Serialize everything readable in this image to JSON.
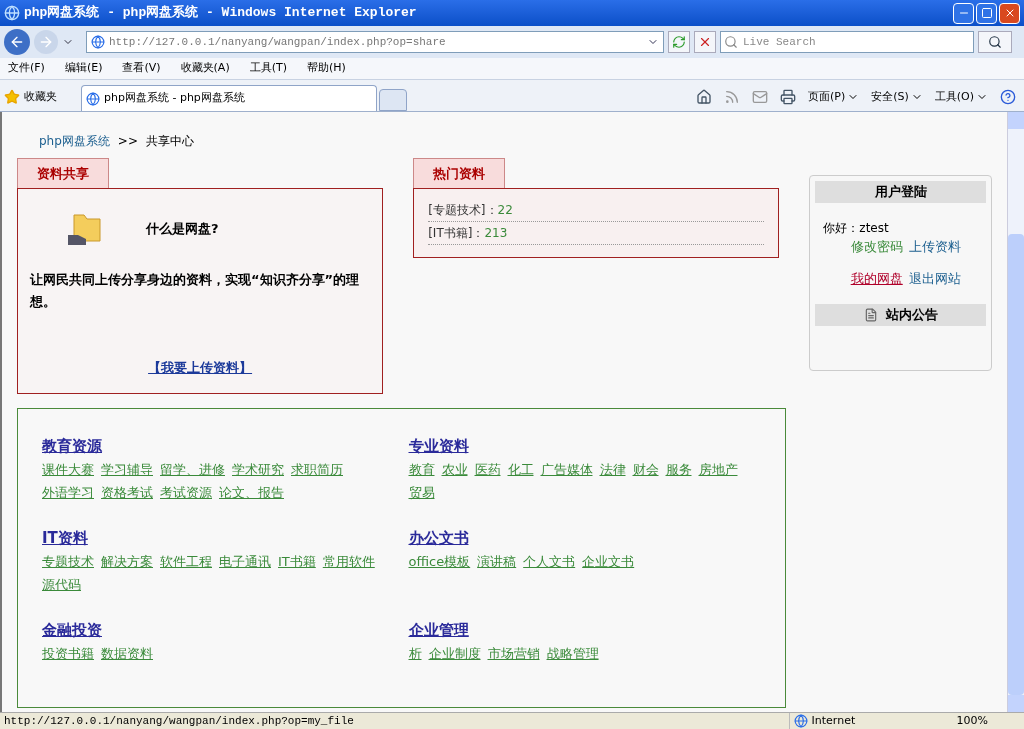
{
  "window": {
    "title": "php网盘系统 - php网盘系统 - Windows Internet Explorer"
  },
  "address_bar": {
    "url": "http://127.0.0.1/nanyang/wangpan/index.php?op=share"
  },
  "search": {
    "placeholder": "Live Search"
  },
  "menu": [
    "文件(F)",
    "编辑(E)",
    "查看(V)",
    "收藏夹(A)",
    "工具(T)",
    "帮助(H)"
  ],
  "favorites": {
    "label": "收藏夹"
  },
  "tabs": [
    {
      "label": "php网盘系统 - php网盘系统",
      "selected": true
    }
  ],
  "command_bar": [
    "页面(P)",
    "安全(S)",
    "工具(O)"
  ],
  "breadcrumb": {
    "home": "php网盘系统",
    "separator": ">>",
    "current": "共享中心"
  },
  "share_panel": {
    "tab": "资料共享",
    "heading": "什么是网盘?",
    "description": "让网民共同上传分享身边的资料，实现“知识齐分享”的理想。",
    "upload_link": "【我要上传资料】"
  },
  "hot_panel": {
    "tab": "热门资料",
    "items": [
      {
        "label": "[专题技术]：",
        "count": "22"
      },
      {
        "label": "[IT书籍]：",
        "count": "213"
      }
    ]
  },
  "login": {
    "title": "用户登陆",
    "greeting": "你好：ztest",
    "links": [
      {
        "label": "修改密码",
        "visited": true,
        "hovered": false
      },
      {
        "label": "上传资料",
        "visited": false,
        "hovered": false
      },
      {
        "label": "我的网盘",
        "visited": false,
        "hovered": true
      },
      {
        "label": "退出网站",
        "visited": false,
        "hovered": false
      }
    ]
  },
  "notice": {
    "title": "站内公告"
  },
  "categories": [
    {
      "title": "教育资源",
      "links": [
        "课件大赛",
        "学习辅导",
        "留学、进修",
        "学术研究",
        "求职简历",
        "外语学习",
        "资格考试",
        "考试资源",
        "论文、报告"
      ]
    },
    {
      "title": "专业资料",
      "links": [
        "教育",
        "农业",
        "医药",
        "化工",
        "广告媒体",
        "法律",
        "财会",
        "服务",
        "房地产",
        "贸易"
      ]
    },
    {
      "title": "IT资料",
      "links": [
        "专题技术",
        "解决方案",
        "软件工程",
        "电子通讯",
        "IT书籍",
        "常用软件",
        "源代码"
      ]
    },
    {
      "title": "办公文书",
      "links": [
        "office模板",
        "演讲稿",
        "个人文书",
        "企业文书"
      ]
    },
    {
      "title": "金融投资",
      "links": [
        "投资书籍",
        "数据资料"
      ]
    },
    {
      "title": "企业管理",
      "links": [
        "析",
        "企业制度",
        "市场营销",
        "战略管理"
      ]
    }
  ],
  "status_bar": {
    "url": "http://127.0.0.1/nanyang/wangpan/index.php?op=my_file",
    "zone": "Internet",
    "zoom": "100%"
  }
}
